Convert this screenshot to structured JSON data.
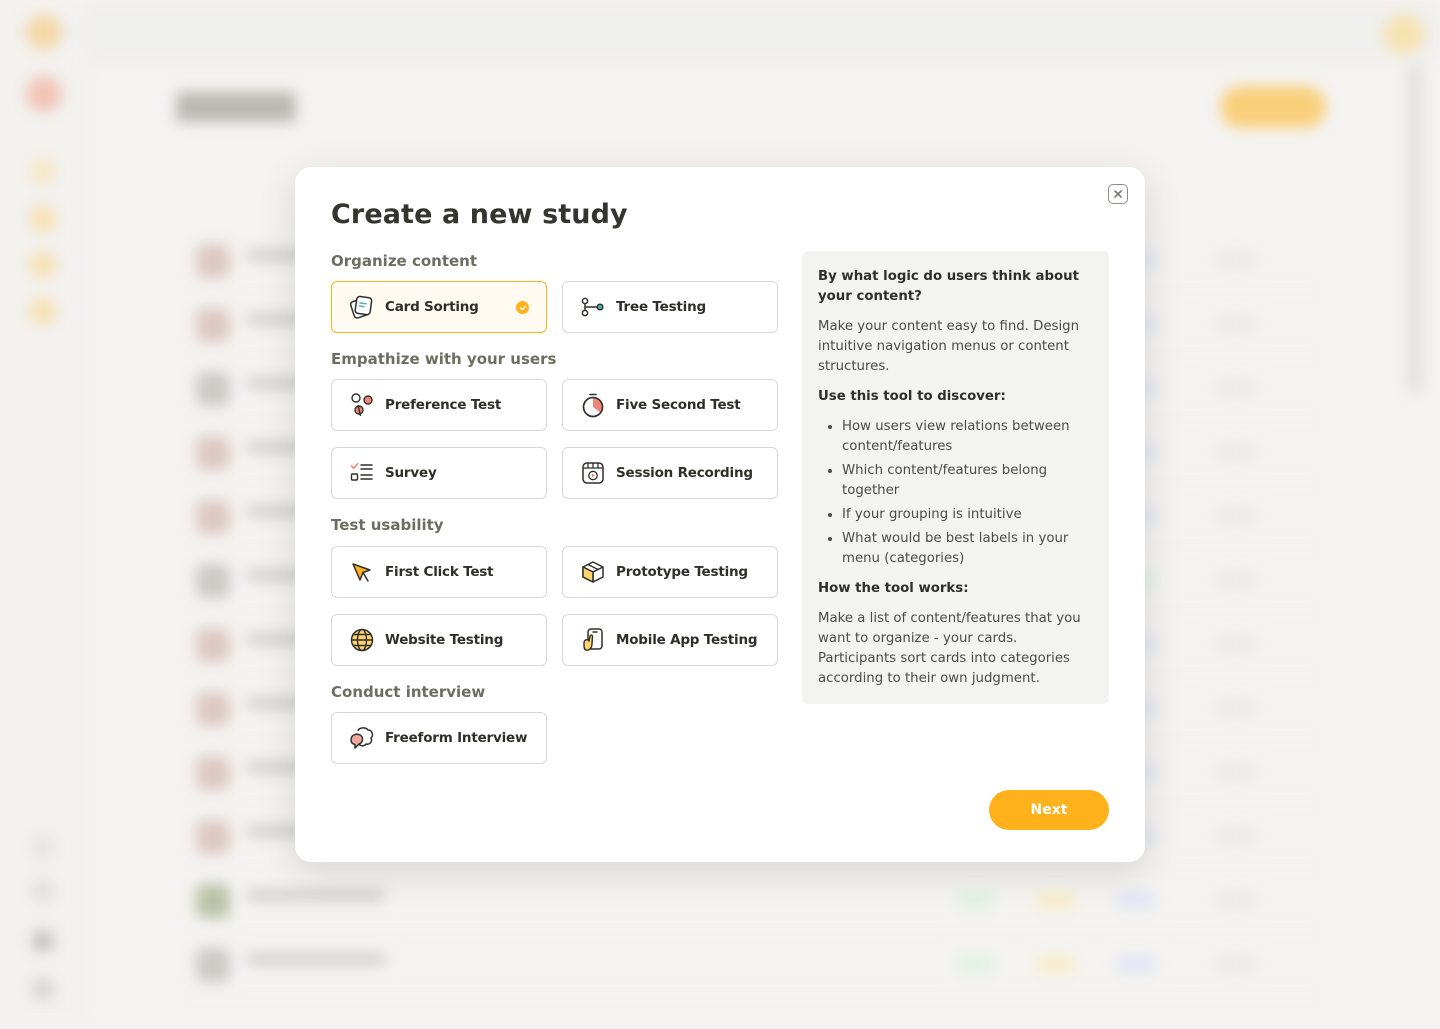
{
  "modal": {
    "title": "Create a new study",
    "sections": [
      {
        "label": "Organize content",
        "items": [
          {
            "label": "Card Sorting",
            "icon": "card-sorting-icon",
            "selected": true
          },
          {
            "label": "Tree Testing",
            "icon": "tree-testing-icon"
          }
        ]
      },
      {
        "label": "Empathize with your users",
        "items": [
          {
            "label": "Preference Test",
            "icon": "preference-test-icon"
          },
          {
            "label": "Five Second Test",
            "icon": "stopwatch-icon"
          },
          {
            "label": "Survey",
            "icon": "checklist-icon"
          },
          {
            "label": "Session Recording",
            "icon": "video-recording-icon"
          }
        ]
      },
      {
        "label": "Test usability",
        "items": [
          {
            "label": "First Click Test",
            "icon": "cursor-click-icon"
          },
          {
            "label": "Prototype Testing",
            "icon": "cube-icon"
          },
          {
            "label": "Website Testing",
            "icon": "globe-icon"
          },
          {
            "label": "Mobile App Testing",
            "icon": "mobile-tap-icon"
          }
        ]
      },
      {
        "label": "Conduct interview",
        "items": [
          {
            "label": "Freeform Interview",
            "icon": "chat-bubbles-icon"
          }
        ]
      }
    ],
    "info": {
      "heading": "By what logic do users think about your content?",
      "intro": "Make your content easy to find. Design intuitive navigation menus or content structures.",
      "discover_heading": "Use this tool to discover:",
      "discover_items": [
        "How users view relations between content/features",
        "Which content/features belong together",
        "If your grouping is intuitive",
        "What would be best labels in your menu (categories)"
      ],
      "how_heading": "How the tool works:",
      "how_text": "Make a list of content/features that you want to organize - your cards. Participants sort cards into categories according to their own judgment."
    },
    "next_label": "Next"
  },
  "colors": {
    "accent": "#ffb21c",
    "selected_bg": "#fffbf2",
    "info_bg": "#f3f3f1",
    "coral": "#f2857a",
    "teal": "#4bb7b0"
  }
}
